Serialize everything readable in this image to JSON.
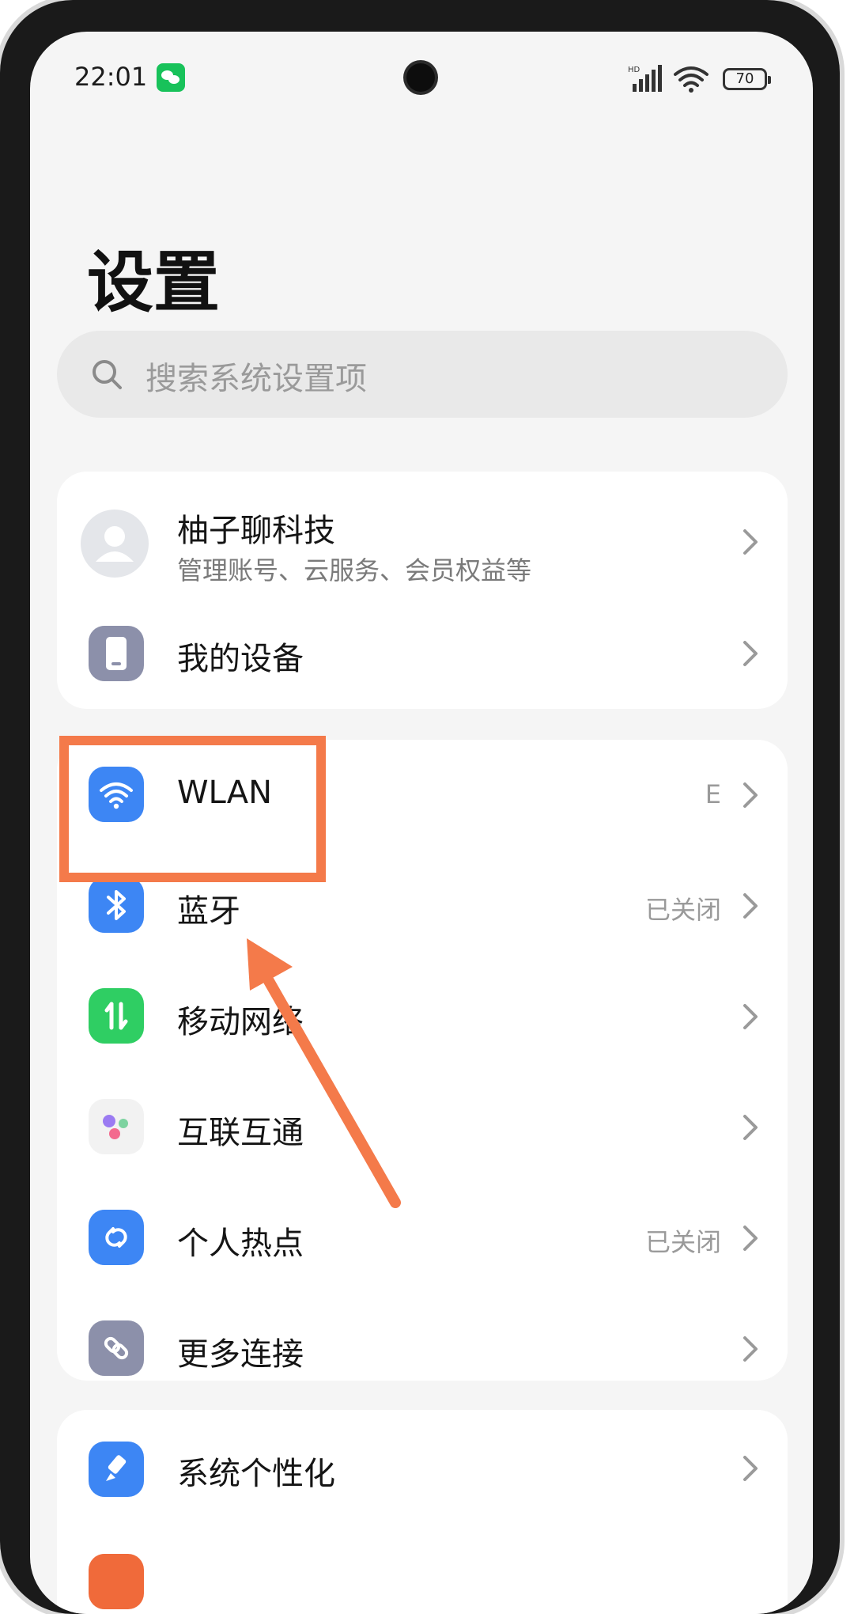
{
  "status_bar": {
    "time": "22:01",
    "battery": "70",
    "hd_label": "HD"
  },
  "page": {
    "title": "设置"
  },
  "search": {
    "placeholder": "搜索系统设置项"
  },
  "account": {
    "name": "柚子聊科技",
    "subtitle": "管理账号、云服务、会员权益等"
  },
  "my_device": {
    "label": "我的设备"
  },
  "connections": [
    {
      "label": "WLAN",
      "value": "E",
      "icon": "wifi-icon",
      "color": "#3d86f4"
    },
    {
      "label": "蓝牙",
      "value": "已关闭",
      "icon": "bluetooth-icon",
      "color": "#3d86f4"
    },
    {
      "label": "移动网络",
      "value": "",
      "icon": "mobile-data-icon",
      "color": "#2fce63"
    },
    {
      "label": "互联互通",
      "value": "",
      "icon": "interconnect-icon",
      "color": "#f2f2f2"
    },
    {
      "label": "个人热点",
      "value": "已关闭",
      "icon": "hotspot-icon",
      "color": "#3d86f4"
    },
    {
      "label": "更多连接",
      "value": "",
      "icon": "link-icon",
      "color": "#8c90aa"
    }
  ],
  "personalize": {
    "label": "系统个性化",
    "icon": "brush-icon",
    "color": "#3d86f4"
  },
  "colors": {
    "accent": "#3d86f4",
    "highlight": "#f47a4a"
  }
}
